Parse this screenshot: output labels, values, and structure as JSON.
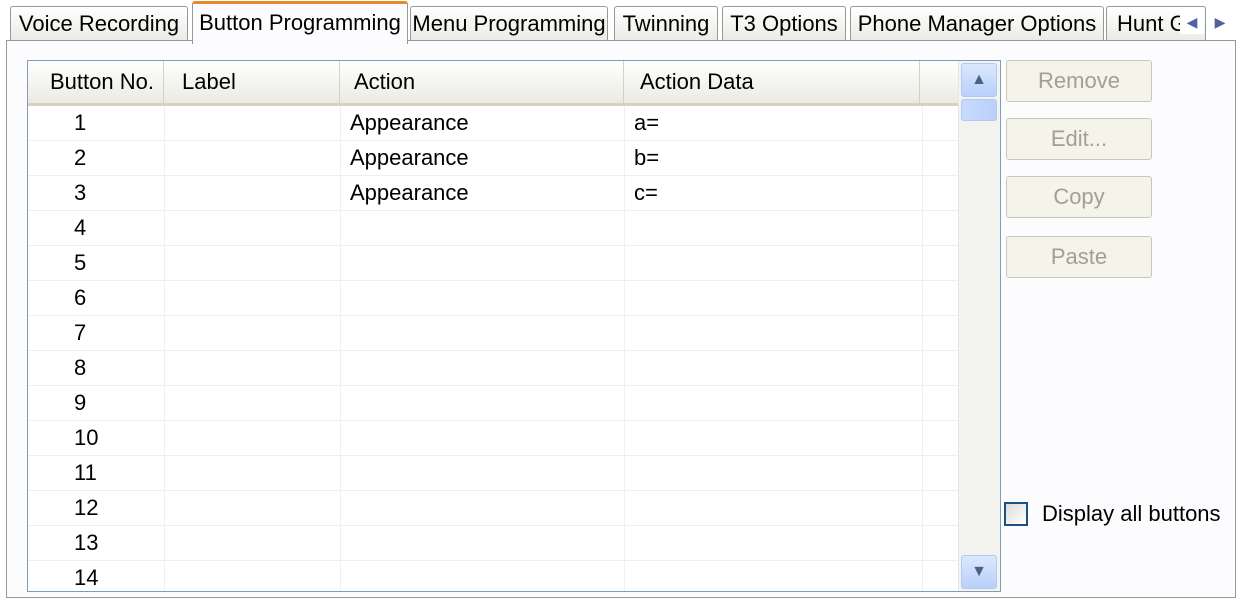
{
  "tabs": [
    {
      "label": "Voice Recording",
      "active": false
    },
    {
      "label": "Button Programming",
      "active": true
    },
    {
      "label": "Menu Programming",
      "active": false
    },
    {
      "label": "Twinning",
      "active": false
    },
    {
      "label": "T3 Options",
      "active": false
    },
    {
      "label": "Phone Manager Options",
      "active": false
    },
    {
      "label": "Hunt G",
      "active": false
    }
  ],
  "tab_scroll": {
    "left": "◀",
    "right": "▶"
  },
  "table": {
    "columns": [
      "Button No.",
      "Label",
      "Action",
      "Action Data"
    ],
    "rows": [
      {
        "button_no": "1",
        "label": "",
        "action": "Appearance",
        "action_data": "a="
      },
      {
        "button_no": "2",
        "label": "",
        "action": "Appearance",
        "action_data": "b="
      },
      {
        "button_no": "3",
        "label": "",
        "action": "Appearance",
        "action_data": "c="
      },
      {
        "button_no": "4",
        "label": "",
        "action": "",
        "action_data": ""
      },
      {
        "button_no": "5",
        "label": "",
        "action": "",
        "action_data": ""
      },
      {
        "button_no": "6",
        "label": "",
        "action": "",
        "action_data": ""
      },
      {
        "button_no": "7",
        "label": "",
        "action": "",
        "action_data": ""
      },
      {
        "button_no": "8",
        "label": "",
        "action": "",
        "action_data": ""
      },
      {
        "button_no": "9",
        "label": "",
        "action": "",
        "action_data": ""
      },
      {
        "button_no": "10",
        "label": "",
        "action": "",
        "action_data": ""
      },
      {
        "button_no": "11",
        "label": "",
        "action": "",
        "action_data": ""
      },
      {
        "button_no": "12",
        "label": "",
        "action": "",
        "action_data": ""
      },
      {
        "button_no": "13",
        "label": "",
        "action": "",
        "action_data": ""
      },
      {
        "button_no": "14",
        "label": "",
        "action": "",
        "action_data": ""
      }
    ]
  },
  "scroll": {
    "up": "▲",
    "down": "▼"
  },
  "buttons": {
    "remove": "Remove",
    "edit": "Edit...",
    "copy": "Copy",
    "paste": "Paste"
  },
  "display_all": {
    "label": "Display all buttons",
    "checked": false
  },
  "colors": {
    "active_tab_accent": "#e68b2c",
    "disabled_text": "#a1a192",
    "scroll_blue": "#b9d0fa"
  }
}
